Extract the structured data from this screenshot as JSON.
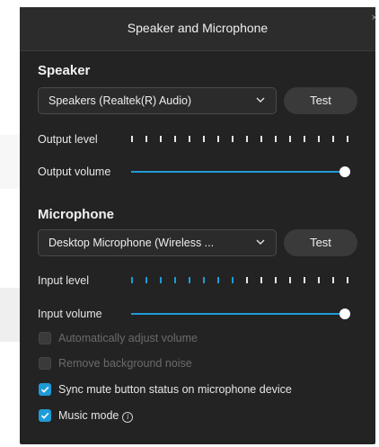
{
  "window": {
    "title": "Speaker and Microphone",
    "close_label": "×"
  },
  "speaker": {
    "section_title": "Speaker",
    "device": "Speakers (Realtek(R) Audio)",
    "test_label": "Test",
    "output_level_label": "Output level",
    "output_level": {
      "total_ticks": 16,
      "active_ticks": 0
    },
    "output_volume_label": "Output volume",
    "output_volume": 1.0
  },
  "microphone": {
    "section_title": "Microphone",
    "device": "Desktop Microphone (Wireless ...",
    "test_label": "Test",
    "input_level_label": "Input level",
    "input_level": {
      "total_ticks": 16,
      "active_ticks": 8
    },
    "input_volume_label": "Input volume",
    "input_volume": 1.0
  },
  "options": [
    {
      "label": "Automatically adjust volume",
      "checked": false,
      "enabled": false
    },
    {
      "label": "Remove background noise",
      "checked": false,
      "enabled": false
    },
    {
      "label": "Sync mute button status on microphone device",
      "checked": true,
      "enabled": true
    },
    {
      "label": "Music mode",
      "checked": true,
      "enabled": true,
      "info_icon": "info-icon"
    }
  ],
  "colors": {
    "panel_bg": "#232323",
    "accent": "#1e9bd7",
    "text": "#e6e6e6",
    "disabled_text": "#6b6b6b"
  }
}
